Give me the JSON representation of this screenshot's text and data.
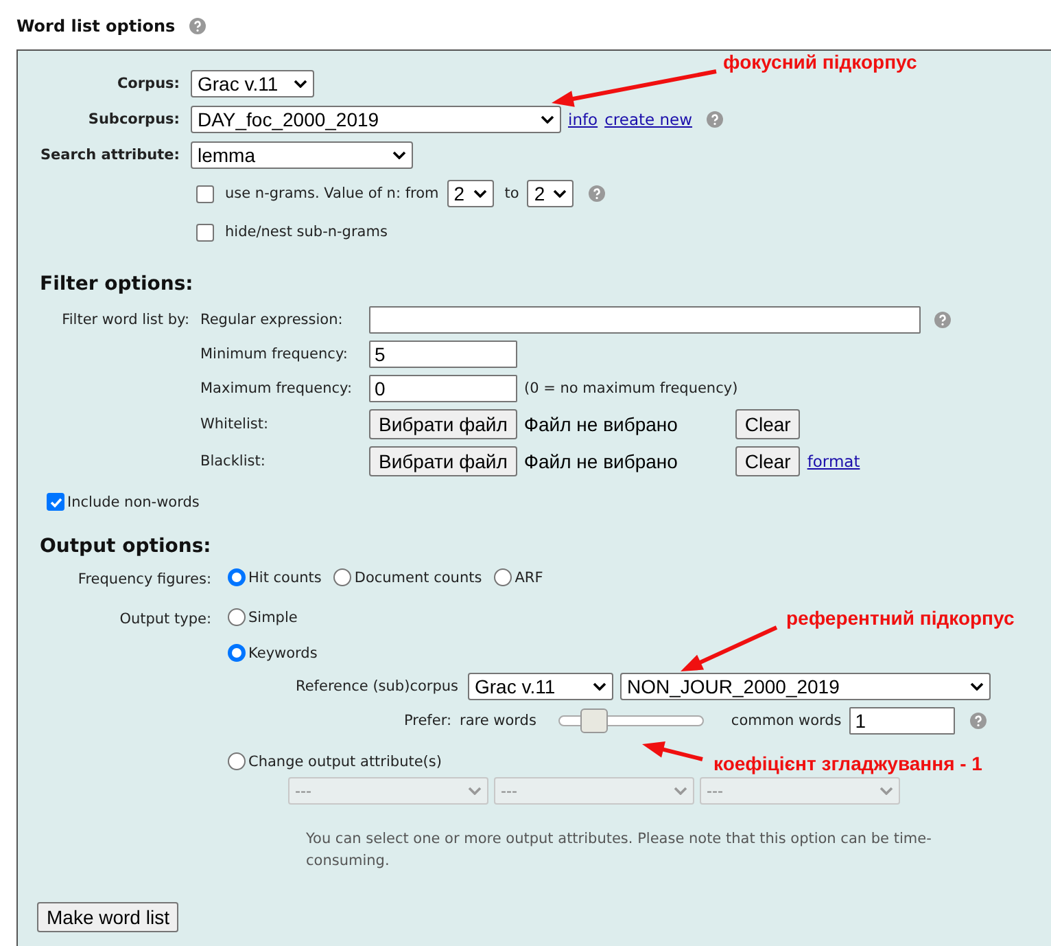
{
  "title": "Word list options",
  "corpus": {
    "label": "Corpus:",
    "value": "Grac v.11"
  },
  "subcorpus": {
    "label": "Subcorpus:",
    "value": "DAY_foc_2000_2019",
    "links": [
      "info",
      "create new"
    ]
  },
  "search_attribute": {
    "label": "Search attribute:",
    "value": "lemma"
  },
  "ngrams": {
    "checked": false,
    "label": "use n-grams. Value of n: from",
    "from": "2",
    "to_label": "to",
    "to": "2"
  },
  "hide_subngrams": {
    "checked": false,
    "label": "hide/nest sub-n-grams"
  },
  "filter": {
    "heading": "Filter options:",
    "by_label": "Filter word list by:",
    "rows": [
      {
        "kind": "pattern",
        "label": "Regular expression:",
        "value": ""
      },
      {
        "kind": "text",
        "label": "Minimum frequency:",
        "value": "5"
      },
      {
        "kind": "text",
        "label": "Maximum frequency:",
        "value": "0",
        "note": "(0 = no maximum frequency)"
      },
      {
        "kind": "file",
        "label": "Whitelist:",
        "button": "Вибрати файл",
        "status": "Файл не вибрано",
        "clear": "Clear"
      },
      {
        "kind": "file",
        "label": "Blacklist:",
        "button": "Вибрати файл",
        "status": "Файл не вибрано",
        "clear": "Clear",
        "link": "format"
      }
    ]
  },
  "include_nonwords": {
    "checked": true,
    "label": "Include non-words"
  },
  "output": {
    "heading": "Output options:",
    "frequency": {
      "label": "Frequency figures:",
      "options": [
        {
          "label": "Hit counts",
          "selected": true
        },
        {
          "label": "Document counts",
          "selected": false
        },
        {
          "label": "ARF",
          "selected": false
        }
      ]
    },
    "output_type": {
      "label": "Output type:",
      "options": [
        {
          "kind": "simple",
          "label": "Simple",
          "selected": false
        },
        {
          "kind": "keywords",
          "label": "Keywords",
          "selected": true,
          "reference_label": "Reference (sub)corpus",
          "reference_corpus": "Grac v.11",
          "reference_subcorpus": "NON_JOUR_2000_2019",
          "prefer_label": "Prefer:",
          "rare_label": "rare words",
          "common_label": "common words",
          "level": 0.19,
          "smoothing": "1"
        },
        {
          "kind": "attributes",
          "label": "Change output attribute(s)",
          "selected": false,
          "attributes": [
            "---",
            "---",
            "---"
          ],
          "note": "You can select one or more output attributes. Please note that this option can be time-consuming."
        }
      ]
    }
  },
  "submit": "Make word list",
  "annotations": [
    {
      "text": "фокусний підкорпус"
    },
    {
      "text": "референтний підкорпус"
    },
    {
      "text": "коефіцієнт згладжування - 1"
    }
  ]
}
